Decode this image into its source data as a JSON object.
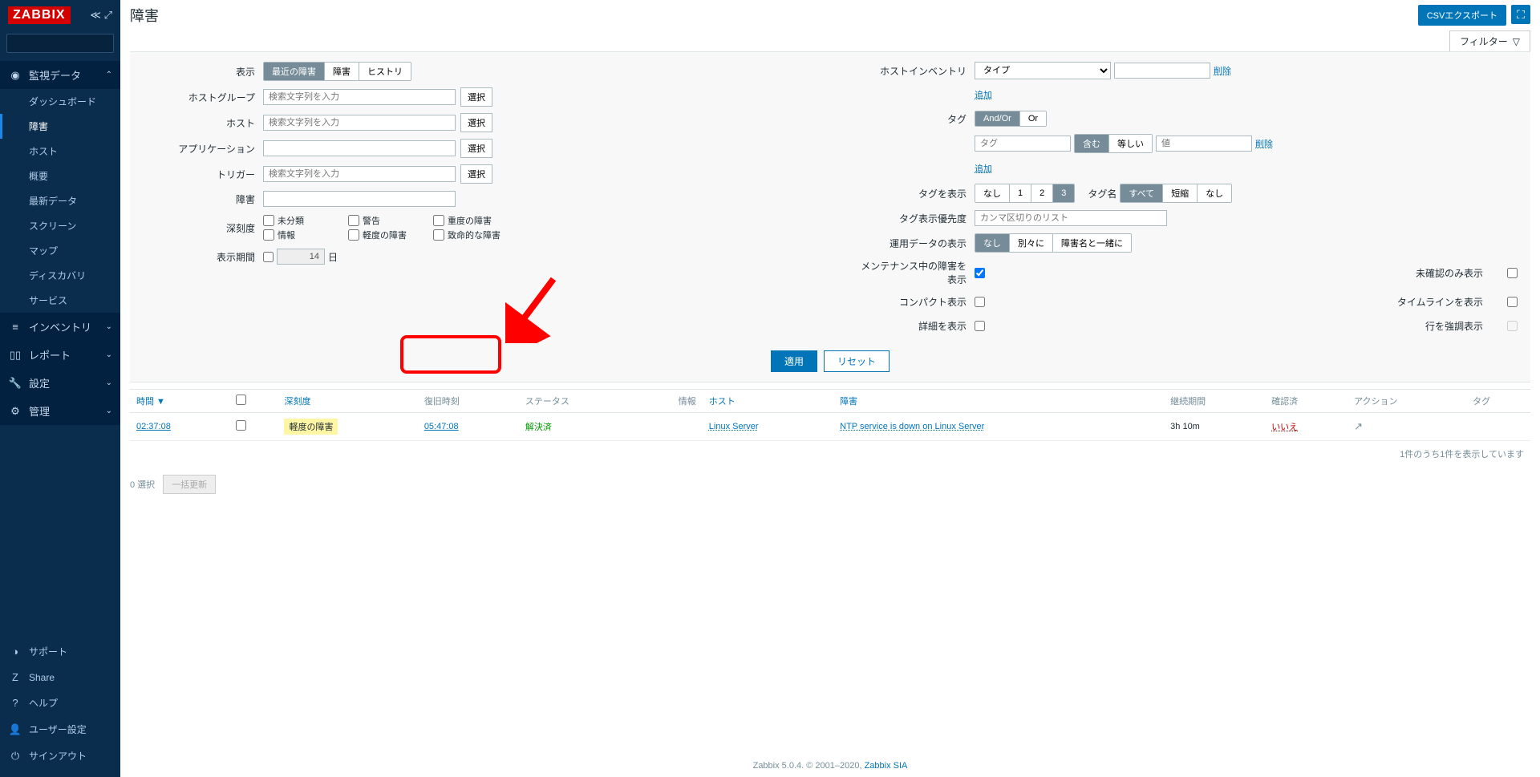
{
  "app": {
    "logo": "ZABBIX"
  },
  "page": {
    "title": "障害",
    "csv_export": "CSVエクスポート"
  },
  "sidebar": {
    "menus": [
      {
        "icon": "◉",
        "label": "監視データ",
        "expanded": true
      },
      {
        "icon": "≡",
        "label": "インベントリ",
        "expanded": false
      },
      {
        "icon": "▯▯",
        "label": "レポート",
        "expanded": false
      },
      {
        "icon": "🔧",
        "label": "設定",
        "expanded": false
      },
      {
        "icon": "⚙",
        "label": "管理",
        "expanded": false
      }
    ],
    "submenu": [
      "ダッシュボード",
      "障害",
      "ホスト",
      "概要",
      "最新データ",
      "スクリーン",
      "マップ",
      "ディスカバリ",
      "サービス"
    ],
    "footer": [
      {
        "icon": "◑",
        "label": "サポート"
      },
      {
        "icon": "Z",
        "label": "Share"
      },
      {
        "icon": "?",
        "label": "ヘルプ"
      },
      {
        "icon": "👤",
        "label": "ユーザー設定"
      },
      {
        "icon": "⏻",
        "label": "サインアウト"
      }
    ]
  },
  "filter": {
    "tab": "フィルター",
    "left": {
      "show_label": "表示",
      "show_opts": [
        "最近の障害",
        "障害",
        "ヒストリ"
      ],
      "hostgroup_label": "ホストグループ",
      "hostgroup_ph": "検索文字列を入力",
      "host_label": "ホスト",
      "host_ph": "検索文字列を入力",
      "app_label": "アプリケーション",
      "trigger_label": "トリガー",
      "trigger_ph": "検索文字列を入力",
      "problem_label": "障害",
      "severity_label": "深刻度",
      "sev_opts": [
        "未分類",
        "警告",
        "重度の障害",
        "情報",
        "軽度の障害",
        "致命的な障害"
      ],
      "age_label": "表示期間",
      "age_days": "14",
      "age_unit": "日",
      "select_btn": "選択"
    },
    "right": {
      "inventory_label": "ホストインベントリ",
      "inventory_type": "タイプ",
      "delete": "削除",
      "add": "追加",
      "tags_label": "タグ",
      "tags_andor": [
        "And/Or",
        "Or"
      ],
      "tag_ph": "タグ",
      "tag_contains": [
        "含む",
        "等しい"
      ],
      "tag_value_ph": "値",
      "show_tags_label": "タグを表示",
      "show_tags_opts": [
        "なし",
        "1",
        "2",
        "3"
      ],
      "tagname_label": "タグ名",
      "tagname_opts": [
        "すべて",
        "短縮",
        "なし"
      ],
      "tag_priority_label": "タグ表示優先度",
      "tag_priority_ph": "カンマ区切りのリスト",
      "opdata_label": "運用データの表示",
      "opdata_opts": [
        "なし",
        "別々に",
        "障害名と一緒に"
      ],
      "maint_label": "メンテナンス中の障害を表示",
      "unack_label": "未確認のみ表示",
      "compact_label": "コンパクト表示",
      "timeline_label": "タイムラインを表示",
      "details_label": "詳細を表示",
      "highlight_label": "行を強調表示"
    },
    "apply": "適用",
    "reset": "リセット"
  },
  "table": {
    "headers": {
      "time": "時間",
      "severity": "深刻度",
      "recovery": "復旧時刻",
      "status": "ステータス",
      "info": "情報",
      "host": "ホスト",
      "problem": "障害",
      "duration": "継続期間",
      "ack": "確認済",
      "actions": "アクション",
      "tags": "タグ"
    },
    "rows": [
      {
        "time": "02:37:08",
        "severity": "軽度の障害",
        "recovery": "05:47:08",
        "status": "解決済",
        "host": "Linux Server",
        "problem": "NTP service is down on Linux Server",
        "duration": "3h 10m",
        "ack": "いいえ"
      }
    ],
    "footer": "1件のうち1件を表示しています"
  },
  "mass": {
    "selected": "0 選択",
    "btn": "一括更新"
  },
  "footer_text": {
    "prefix": "Zabbix 5.0.4. © 2001–2020, ",
    "link": "Zabbix SIA"
  }
}
